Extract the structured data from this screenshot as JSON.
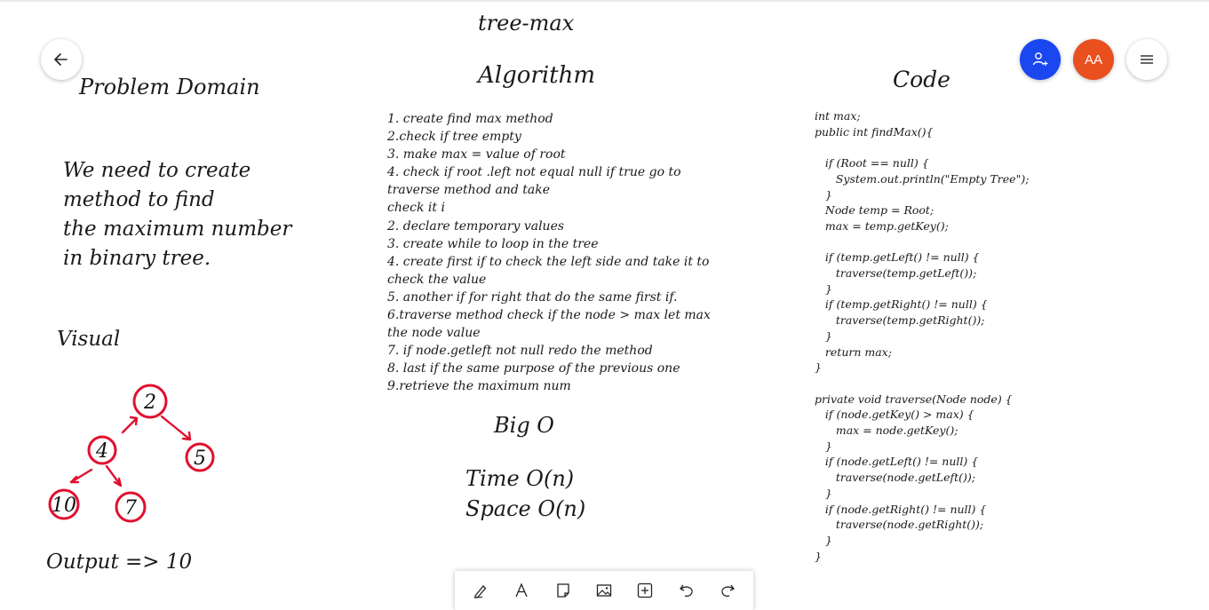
{
  "board": {
    "title": "tree-max",
    "algorithm_heading": "Algorithm",
    "problem_heading": "Problem Domain",
    "code_heading": "Code",
    "visual_heading": "Visual",
    "bigo_heading": "Big O",
    "problem_lines": [
      "We need to create",
      "method to find",
      "the maximum number",
      "in binary tree."
    ],
    "algorithm_lines": [
      "1. create find max method",
      "2.check if tree empty",
      "3. make max = value of root",
      "4. check if root .left not equal null if true go to",
      "traverse method and take",
      "check it i",
      "2. declare temporary values",
      "3. create while to loop in the tree",
      "4. create first if to check the left side and take it to",
      "check the value",
      "5. another if for right that do the same first if.",
      "6.traverse method check if the node > max let max",
      "the node value",
      "7. if node.getleft not null redo the method",
      "8. last if the same purpose of the previous one",
      "9.retrieve the maximum num"
    ],
    "complexity_lines": [
      "Time O(n)",
      "Space O(n)"
    ],
    "output_text": "Output => 10",
    "tree_nodes": [
      "2",
      "4",
      "5",
      "10",
      "7"
    ],
    "code_lines": [
      "int max;",
      "public int findMax(){",
      "",
      "   if (Root == null) {",
      "      System.out.println(\"Empty Tree\");",
      "   }",
      "   Node temp = Root;",
      "   max = temp.getKey();",
      "",
      "   if (temp.getLeft() != null) {",
      "      traverse(temp.getLeft());",
      "   }",
      "   if (temp.getRight() != null) {",
      "      traverse(temp.getRight());",
      "   }",
      "   return max;",
      "}",
      "",
      "private void traverse(Node node) {",
      "   if (node.getKey() > max) {",
      "      max = node.getKey();",
      "   }",
      "   if (node.getLeft() != null) {",
      "      traverse(node.getLeft());",
      "   }",
      "   if (node.getRight() != null) {",
      "      traverse(node.getRight());",
      "   }",
      "}"
    ]
  },
  "header": {
    "avatar_initials": "AA"
  },
  "colors": {
    "share_button": "#1a47f0",
    "avatar": "#e8501f",
    "tree_ink": "#e0102f"
  },
  "icons": {
    "back": "arrow-left-icon",
    "share": "add-person-icon",
    "menu": "hamburger-menu-icon",
    "tools": [
      "pen-icon",
      "text-icon",
      "sticky-note-icon",
      "image-icon",
      "add-icon",
      "undo-icon",
      "redo-icon"
    ]
  }
}
